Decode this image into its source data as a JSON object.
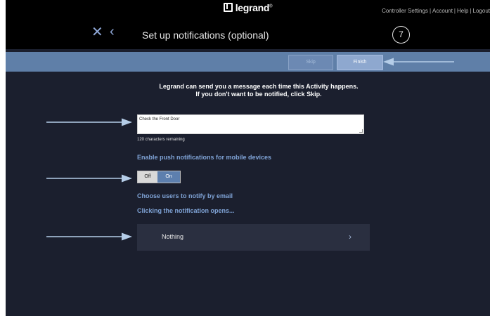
{
  "header": {
    "logo_text": "legrand",
    "logo_mark": "®",
    "links": [
      "Controller Settings",
      "Account",
      "Help",
      "Logout"
    ],
    "separator": "|",
    "close_icon": "close-icon",
    "back_icon": "chevron-left-icon",
    "title": "Set up notifications (optional)",
    "step_number": "7"
  },
  "actions": {
    "skip_label": "Skip",
    "finish_label": "Finish"
  },
  "content": {
    "intro_line1": "Legrand can send you a message each time this Activity happens.",
    "intro_line2": "If you don't want to be notified, click Skip.",
    "message_value": "Check the Front Door",
    "chars_remaining": "120 characters remaining",
    "push_label": "Enable push notifications for mobile devices",
    "toggle_off": "Off",
    "toggle_on": "On",
    "toggle_selected": "On",
    "email_label": "Choose users to notify by email",
    "click_label": "Clicking the notification opens...",
    "open_option": "Nothing",
    "option_icon": "chevron-right-icon"
  },
  "colors": {
    "background": "#1b1f2e",
    "header": "#000000",
    "action_bar": "#5f7fa8",
    "link_accent": "#7fa3d6",
    "annotation_arrow": "#b5cde8"
  }
}
